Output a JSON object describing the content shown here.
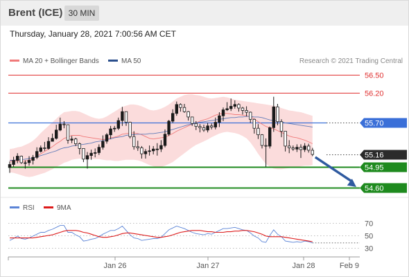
{
  "header": {
    "instrument": "Brent (ICE)",
    "timeframe": "30 MIN"
  },
  "timestamp": "Thursday, January 28, 2021 7:00:56 AM CET",
  "credit": "Research © 2021 Trading Central",
  "colors": {
    "bollinger_fill": "#fbdcdc",
    "ma20": "#f07a7a",
    "ma50": "#5e7ab8",
    "candle": "#1a1a1a",
    "resistance": "#e03030",
    "pivot": "#3a6fd8",
    "support": "#1e8a1e",
    "arrow": "#2f5aa0",
    "rsi": "#5b84d6",
    "rsi_ma": "#dd1b1b"
  },
  "chart_data": [
    {
      "type": "candlestick",
      "legend": [
        {
          "label": "MA 20 + Bollinger Bands",
          "color": "#f07a7a"
        },
        {
          "label": "MA 50",
          "color": "#2a4f8c"
        }
      ],
      "x_ticks": [
        "Jan 26",
        "Jan 27",
        "Jan 28",
        "Feb 9"
      ],
      "ylim": [
        54.5,
        56.7
      ],
      "levels": [
        {
          "label": "56.50",
          "value": 56.5,
          "kind": "resistance",
          "color": "#e03030"
        },
        {
          "label": "56.20",
          "value": 56.2,
          "kind": "resistance",
          "color": "#e03030"
        },
        {
          "label": "55.70",
          "value": 55.7,
          "kind": "pivot",
          "color": "#3a6fd8"
        },
        {
          "label": "55.16",
          "value": 55.16,
          "kind": "last",
          "color": "#2b2b2b"
        },
        {
          "label": "54.95",
          "value": 54.95,
          "kind": "support",
          "color": "#1e8a1e"
        },
        {
          "label": "54.60",
          "value": 54.6,
          "kind": "support",
          "color": "#1e8a1e"
        }
      ],
      "close": [
        54.99,
        55.06,
        55.13,
        55.02,
        55.02,
        55.06,
        55.11,
        55.21,
        55.27,
        55.26,
        55.38,
        55.43,
        55.57,
        55.67,
        55.66,
        55.4,
        55.42,
        55.34,
        55.26,
        55.08,
        55.14,
        55.18,
        55.19,
        55.28,
        55.38,
        55.49,
        55.59,
        55.6,
        55.73,
        55.88,
        55.7,
        55.46,
        55.29,
        55.27,
        55.17,
        55.21,
        55.22,
        55.25,
        55.25,
        55.31,
        55.5,
        55.72,
        55.85,
        56.0,
        55.95,
        55.88,
        55.79,
        55.68,
        55.63,
        55.61,
        55.57,
        55.64,
        55.62,
        55.7,
        55.81,
        55.91,
        55.93,
        55.97,
        56.0,
        55.94,
        55.9,
        55.87,
        55.75,
        55.6,
        55.49,
        55.31,
        55.3,
        55.61,
        55.96,
        55.71,
        55.55,
        55.3,
        55.27,
        55.25,
        55.28,
        55.24,
        55.3,
        55.23,
        55.16
      ],
      "high": [
        55.04,
        55.12,
        55.18,
        55.14,
        55.06,
        55.13,
        55.15,
        55.28,
        55.31,
        55.37,
        55.45,
        55.51,
        55.66,
        55.78,
        55.72,
        55.5,
        55.47,
        55.44,
        55.36,
        55.2,
        55.2,
        55.24,
        55.26,
        55.33,
        55.48,
        55.52,
        55.64,
        55.64,
        55.78,
        55.96,
        55.77,
        55.71,
        55.55,
        55.39,
        55.3,
        55.25,
        55.31,
        55.3,
        55.35,
        55.4,
        55.58,
        55.74,
        55.92,
        56.05,
        56.02,
        56.01,
        55.89,
        55.76,
        55.72,
        55.67,
        55.66,
        55.69,
        55.68,
        55.78,
        55.87,
        55.95,
        56.04,
        56.1,
        56.07,
        56.02,
        55.96,
        55.97,
        55.88,
        55.76,
        55.67,
        55.5,
        55.43,
        55.63,
        56.13,
        56.01,
        55.75,
        55.52,
        55.4,
        55.31,
        55.33,
        55.33,
        55.35,
        55.34,
        55.27
      ],
      "low": [
        54.85,
        54.95,
        55.01,
        55.0,
        54.92,
        54.97,
        54.99,
        55.08,
        55.19,
        55.22,
        55.24,
        55.38,
        55.41,
        55.55,
        55.6,
        55.34,
        55.35,
        55.3,
        55.16,
        55.03,
        54.92,
        55.07,
        55.11,
        55.15,
        55.24,
        55.34,
        55.42,
        55.54,
        55.57,
        55.64,
        55.64,
        55.43,
        55.24,
        55.22,
        55.09,
        55.09,
        55.14,
        55.16,
        55.14,
        55.2,
        55.28,
        55.47,
        55.69,
        55.81,
        55.88,
        55.86,
        55.73,
        55.64,
        55.57,
        55.53,
        55.54,
        55.53,
        55.58,
        55.58,
        55.62,
        55.72,
        55.89,
        55.89,
        55.93,
        55.88,
        55.83,
        55.8,
        55.69,
        55.51,
        55.42,
        55.26,
        54.95,
        55.26,
        55.54,
        55.65,
        55.45,
        55.21,
        55.18,
        55.22,
        55.2,
        55.1,
        55.2,
        55.19,
        55.13
      ],
      "ma20": [
        55.05,
        55.05,
        55.05,
        55.04,
        55.05,
        55.06,
        55.09,
        55.13,
        55.17,
        55.21,
        55.25,
        55.29,
        55.34,
        55.38,
        55.43,
        55.45,
        55.48,
        55.48,
        55.48,
        55.46,
        55.45,
        55.44,
        55.43,
        55.42,
        55.41,
        55.42,
        55.44,
        55.45,
        55.47,
        55.5,
        55.51,
        55.52,
        55.52,
        55.51,
        55.49,
        55.46,
        55.43,
        55.42,
        55.43,
        55.44,
        55.45,
        55.48,
        55.51,
        55.55,
        55.58,
        55.61,
        55.64,
        55.67,
        55.69,
        55.72,
        55.74,
        55.76,
        55.79,
        55.82,
        55.84,
        55.85,
        55.85,
        55.84,
        55.83,
        55.83,
        55.82,
        55.81,
        55.79,
        55.76,
        55.71,
        55.67,
        55.63,
        55.61,
        55.59,
        55.56,
        55.53,
        55.5,
        55.47,
        55.45,
        55.44,
        55.42,
        55.4,
        55.37,
        55.34
      ],
      "ma50": [
        55.06,
        55.06,
        55.07,
        55.07,
        55.08,
        55.09,
        55.1,
        55.12,
        55.14,
        55.16,
        55.18,
        55.2,
        55.22,
        55.25,
        55.27,
        55.28,
        55.3,
        55.31,
        55.32,
        55.33,
        55.34,
        55.35,
        55.37,
        55.38,
        55.39,
        55.41,
        55.42,
        55.44,
        55.45,
        55.46,
        55.48,
        55.49,
        55.49,
        55.5,
        55.5,
        55.5,
        55.51,
        55.51,
        55.52,
        55.53,
        55.54,
        55.56,
        55.58,
        55.6,
        55.62,
        55.64,
        55.66,
        55.67,
        55.69,
        55.7,
        55.71,
        55.72,
        55.73,
        55.74,
        55.75,
        55.76,
        55.77,
        55.78,
        55.78,
        55.79,
        55.79,
        55.8,
        55.8,
        55.79,
        55.79,
        55.78,
        55.76,
        55.74,
        55.73,
        55.72,
        55.71,
        55.69,
        55.68,
        55.67,
        55.66,
        55.65,
        55.64,
        55.63,
        55.62
      ],
      "bb_upper": [
        55.25,
        55.26,
        55.28,
        55.29,
        55.32,
        55.35,
        55.39,
        55.45,
        55.52,
        55.58,
        55.64,
        55.7,
        55.76,
        55.82,
        55.87,
        55.88,
        55.89,
        55.89,
        55.88,
        55.85,
        55.82,
        55.79,
        55.77,
        55.76,
        55.77,
        55.8,
        55.84,
        55.88,
        55.92,
        55.96,
        55.98,
        56.0,
        56.0,
        55.99,
        55.97,
        55.94,
        55.91,
        55.9,
        55.91,
        55.93,
        55.96,
        56.0,
        56.05,
        56.1,
        56.13,
        56.16,
        56.17,
        56.17,
        56.16,
        56.15,
        56.13,
        56.11,
        56.1,
        56.11,
        56.12,
        56.13,
        56.12,
        56.1,
        56.08,
        56.07,
        56.06,
        56.05,
        56.04,
        56.03,
        56.02,
        56.01,
        56.0,
        55.99,
        55.98,
        55.96,
        55.94,
        55.92,
        55.9,
        55.89,
        55.88,
        55.87,
        55.85,
        55.83,
        55.81
      ],
      "bb_lower": [
        54.86,
        54.85,
        54.83,
        54.81,
        54.79,
        54.78,
        54.79,
        54.81,
        54.83,
        54.85,
        54.88,
        54.91,
        54.95,
        54.98,
        55.02,
        55.04,
        55.07,
        55.08,
        55.09,
        55.08,
        55.08,
        55.08,
        55.08,
        55.08,
        55.07,
        55.06,
        55.06,
        55.05,
        55.05,
        55.06,
        55.07,
        55.07,
        55.07,
        55.06,
        55.04,
        55.01,
        54.98,
        54.96,
        54.95,
        54.95,
        54.97,
        55.0,
        55.03,
        55.08,
        55.13,
        55.18,
        55.23,
        55.28,
        55.32,
        55.35,
        55.38,
        55.41,
        55.45,
        55.48,
        55.51,
        55.53,
        55.54,
        55.53,
        55.52,
        55.5,
        55.47,
        55.43,
        55.36,
        55.27,
        55.17,
        55.08,
        55.0,
        54.95,
        54.92,
        54.91,
        54.91,
        54.92,
        54.93,
        54.94,
        54.95,
        54.96,
        54.97,
        54.97,
        54.98
      ]
    },
    {
      "type": "line",
      "series": [
        {
          "name": "RSI",
          "color": "#5b84d6",
          "values": [
            42,
            45,
            49,
            45,
            44,
            46,
            49,
            52,
            55,
            55,
            58,
            60,
            63,
            66,
            66,
            55,
            55,
            51,
            48,
            41,
            42,
            44,
            45,
            48,
            52,
            55,
            58,
            58,
            61,
            65,
            58,
            51,
            46,
            45,
            42,
            43,
            44,
            45,
            45,
            47,
            53,
            59,
            62,
            65,
            63,
            61,
            58,
            55,
            53,
            52,
            51,
            53,
            52,
            55,
            58,
            61,
            61,
            62,
            63,
            61,
            59,
            58,
            54,
            49,
            46,
            40,
            39,
            50,
            59,
            52,
            48,
            41,
            40,
            39,
            40,
            39,
            41,
            40,
            38
          ]
        },
        {
          "name": "9MA",
          "color": "#dd1b1b",
          "values": [
            46,
            46,
            46,
            46,
            46,
            46,
            46,
            47,
            48,
            49,
            50,
            51,
            53,
            55,
            57,
            58,
            58,
            58,
            57,
            55,
            54,
            52,
            50,
            48,
            47,
            47,
            48,
            49,
            51,
            53,
            54,
            54,
            53,
            52,
            51,
            50,
            49,
            48,
            47,
            47,
            48,
            49,
            51,
            53,
            55,
            56,
            57,
            58,
            58,
            58,
            57,
            56,
            56,
            55,
            55,
            55,
            56,
            56,
            57,
            57,
            58,
            58,
            57,
            56,
            54,
            52,
            49,
            48,
            48,
            48,
            48,
            47,
            46,
            45,
            44,
            43,
            42,
            41,
            40
          ]
        }
      ],
      "y_ticks": [
        "70",
        "50",
        "30"
      ],
      "ylim": [
        20,
        80
      ]
    }
  ]
}
